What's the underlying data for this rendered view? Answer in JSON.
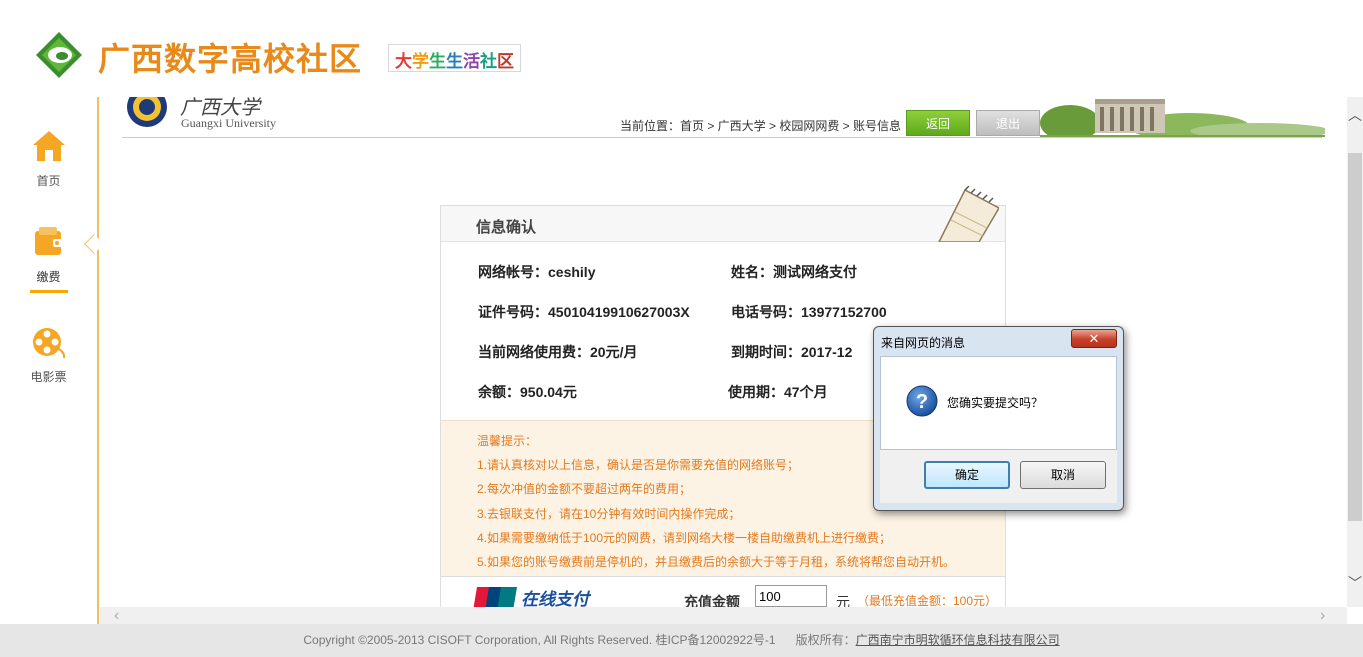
{
  "header": {
    "site_title": "广西数字高校社区",
    "site_sub_chars": [
      "大",
      "学",
      "生",
      "生",
      "活",
      "社",
      "区"
    ]
  },
  "sidebar": {
    "items": [
      {
        "label": "首页",
        "icon": "home-icon"
      },
      {
        "label": "缴费",
        "icon": "wallet-icon",
        "active": true
      },
      {
        "label": "电影票",
        "icon": "film-reel-icon"
      }
    ]
  },
  "frame": {
    "university_cn": "广西大学",
    "university_en": "Guangxi University",
    "breadcrumb": "当前位置：首页 > 广西大学 > 校园网网费 > 账号信息",
    "back_label": "返回",
    "logout_label": "退出"
  },
  "card": {
    "title": "信息确认",
    "fields": {
      "account": "网络帐号：ceshily",
      "name": "姓名：测试网络支付",
      "id_number": "证件号码：45010419910627003X",
      "phone": "电话号码：13977152700",
      "fee": "当前网络使用费：20元/月",
      "expiry": "到期时间：2017-12",
      "balance": "余额：950.04元",
      "period": "使用期：47个月"
    },
    "tips": [
      "温馨提示：",
      "1.请认真核对以上信息，确认是否是你需要充值的网络账号；",
      "2.每次冲值的金额不要超过两年的费用；",
      "3.去银联支付，请在10分钟有效时间内操作完成；",
      "4.如果需要缴纳低于100元的网费，请到网络大楼一楼自助缴费机上进行缴费；",
      "5.如果您的账号缴费前是停机的，并且缴费后的余额大于等于月租，系统将帮您自动开机。"
    ],
    "pay": {
      "online_label": "在线支付",
      "amount_label": "充值金额",
      "amount_value": "100",
      "unit": "元",
      "min_note": "（最低充值金额：100元）"
    }
  },
  "dialog": {
    "title": "来自网页的消息",
    "close_glyph": "✕",
    "message": "您确实要提交吗？",
    "ok_label": "确定",
    "cancel_label": "取消"
  },
  "footer": {
    "copyright": "Copyright ©2005-2013 CISOFT Corporation, All Rights Reserved. 桂ICP备12002922号-1",
    "owner_label": "版权所有：",
    "owner_link": "广西南宁市明软循环信息科技有限公司"
  },
  "colors": {
    "brand_orange": "#e88a1a",
    "back_green": "#6ab524",
    "tip_orange": "#e27a1f",
    "sidebar_border": "#f2c060"
  }
}
